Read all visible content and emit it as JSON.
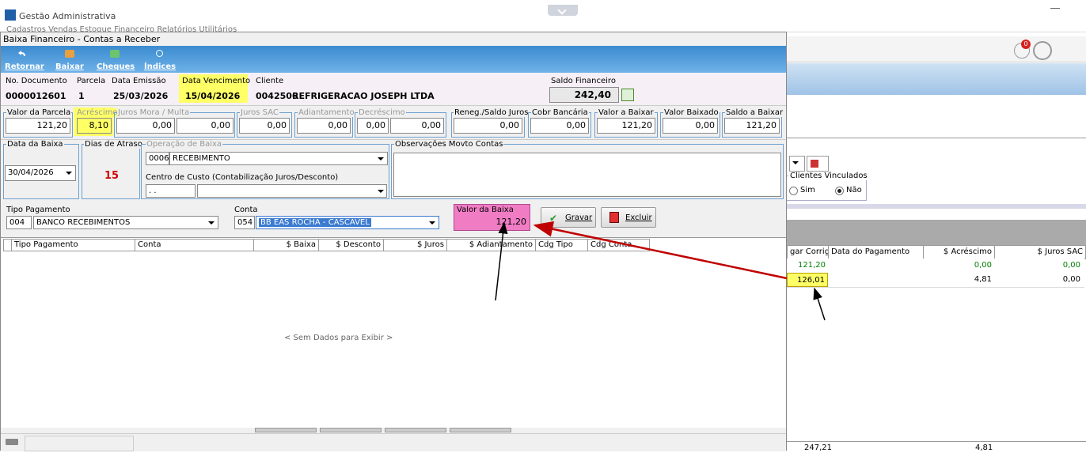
{
  "app": {
    "title": "Gestão Administrativa",
    "menu": "Cadastros   Vendas   Estoque   Financeiro   Relatórios   Utilitários"
  },
  "dialog": {
    "title": "Baixa Financeiro - Contas a Receber",
    "toolbar": {
      "retornar": "Retornar",
      "baixar": "Baixar",
      "cheques": "Cheques",
      "indices": "Índices"
    },
    "header": {
      "no_documento_label": "No. Documento",
      "no_documento": "0000012601",
      "parcela_label": "Parcela",
      "parcela": "1",
      "data_emissao_label": "Data Emissão",
      "data_emissao": "25/03/2026",
      "data_vencimento_label": "Data Vencimento",
      "data_vencimento": "15/04/2026",
      "cliente_label": "Cliente",
      "cliente_codigo": "0042506",
      "cliente_nome": "REFRIGERACAO JOSEPH LTDA",
      "saldo_financeiro_label": "Saldo Financeiro",
      "saldo_financeiro": "242,40"
    },
    "fields": {
      "valor_parcela_label": "Valor da Parcela",
      "valor_parcela": "121,20",
      "acrescimo_label": "Acréscimo",
      "acrescimo": "8,10",
      "juros_mora_label": "Juros Mora / Multa",
      "juros_mora_1": "0,00",
      "juros_mora_2": "0,00",
      "juros_sac_label": "Juros SAC",
      "juros_sac": "0,00",
      "adiantamento_label": "Adiantamento",
      "adiantamento": "0,00",
      "decrescimo_label": "Decréscimo",
      "decrescimo_1": "0,00",
      "decrescimo_2": "0,00",
      "reneg_label": "Reneg./Saldo Juros",
      "reneg": "0,00",
      "cobr_bancaria_label": "Cobr Bancária",
      "cobr_bancaria": "0,00",
      "valor_a_baixar_label": "Valor a Baixar",
      "valor_a_baixar": "121,20",
      "valor_baixado_label": "Valor Baixado",
      "valor_baixado": "0,00",
      "saldo_a_baixar_label": "Saldo a Baixar",
      "saldo_a_baixar": "121,20"
    },
    "baixa": {
      "data_baixa_label": "Data da Baixa",
      "data_baixa": "30/04/2026",
      "dias_atraso_label": "Dias de Atraso",
      "dias_atraso": "15",
      "operacao_label": "Operação de Baixa",
      "operacao_codigo": "0006",
      "operacao_nome": "RECEBIMENTO",
      "centro_custo_label": "Centro de Custo (Contabilização Juros/Desconto)",
      "centro_custo_codigo": " . .",
      "observacoes_label": "Observações Movto Contas"
    },
    "pagamento": {
      "tipo_label": "Tipo Pagamento",
      "tipo_codigo": "004",
      "tipo_nome": "BANCO RECEBIMENTOS",
      "conta_label": "Conta",
      "conta_codigo": "054",
      "conta_nome": "BB EAS ROCHA - CASCAVEL",
      "valor_baixa_label": "Valor da Baixa",
      "valor_baixa": "121,20",
      "gravar": "Gravar",
      "excluir": "Excluir"
    },
    "grid": {
      "columns": [
        "Tipo Pagamento",
        "Conta",
        "$ Baixa",
        "$ Desconto",
        "$ Juros",
        "$ Adiantamento",
        "Cdg Tipo",
        "Cdg Conta"
      ],
      "empty_message": "< Sem Dados para Exibir >"
    }
  },
  "background": {
    "bell_badge": "0",
    "clientes_vinculados_label": "Clientes Vinculados",
    "radio_sim": "Sim",
    "radio_nao": "Não",
    "columns": [
      "gar Corrigido",
      "Data do Pagamento",
      "$ Acréscimo",
      "$ Juros SAC"
    ],
    "rows": [
      {
        "corrigido": "121,20",
        "data_pagamento": "",
        "acrescimo": "0,00",
        "juros_sac": "0,00"
      },
      {
        "corrigido": "126,01",
        "data_pagamento": "",
        "acrescimo": "4,81",
        "juros_sac": "0,00"
      }
    ],
    "bottom_total": "247,21",
    "bottom_acrescimo": "4,81"
  },
  "colors": {
    "toolbar_blue": "#3b8bd0",
    "highlight_yellow": "#ffff66",
    "valor_baixa_pink": "#f07cc4",
    "arrow_red": "#c00000",
    "green_value": "#008000",
    "red_value": "#d00000"
  }
}
